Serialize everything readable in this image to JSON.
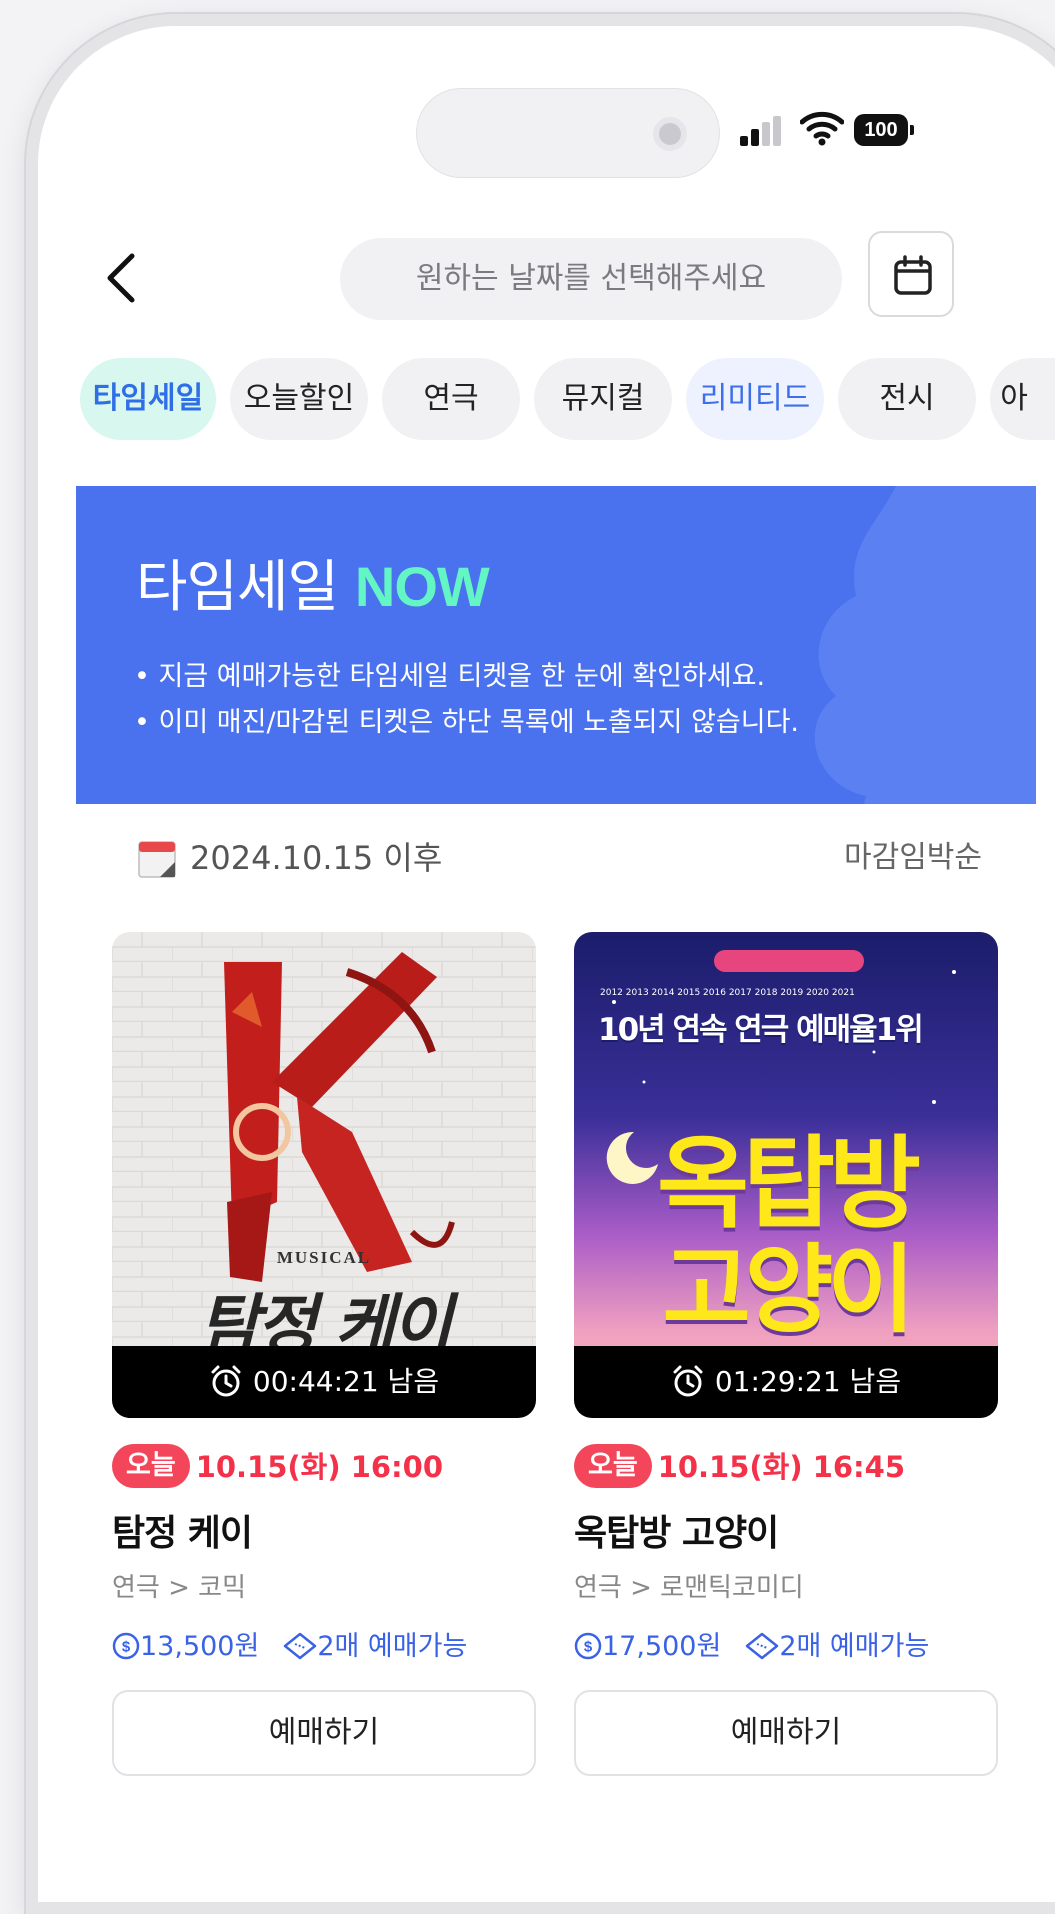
{
  "status_bar": {
    "battery": "100"
  },
  "header": {
    "date_placeholder": "원하는 날짜를 선택해주세요"
  },
  "chips": [
    {
      "label": "타임세일"
    },
    {
      "label": "오늘할인"
    },
    {
      "label": "연극"
    },
    {
      "label": "뮤지컬"
    },
    {
      "label": "리미티드"
    },
    {
      "label": "전시"
    },
    {
      "label": "아"
    }
  ],
  "banner": {
    "title": "타임세일",
    "title_highlight": "NOW",
    "lines": [
      "지금 예매가능한 타임세일 티켓을 한 눈에 확인하세요.",
      "이미 매진/마감된 티켓은 하단 목록에 노출되지 않습니다."
    ]
  },
  "filter": {
    "date": "2024.10.15 이후",
    "sort": "마감임박순"
  },
  "products": [
    {
      "poster_musical": "MUSICAL",
      "poster_title": "탐정 케이",
      "timer": "00:44:21 남음",
      "badge": "오늘",
      "datetime": "10.15(화) 16:00",
      "title": "탐정 케이",
      "category": "연극 > 코믹",
      "price": "13,500원",
      "availability": "2매 예매가능",
      "button": "예매하기"
    },
    {
      "poster_top": "2012 2013 2014 2015 2016 2017 2018 2019 2020 2021",
      "poster_headline": "10년 연속 연극 예매율1위",
      "poster_title_1": "옥탑방",
      "poster_title_2": "고양이",
      "timer": "01:29:21 남음",
      "badge": "오늘",
      "datetime": "10.15(화) 16:45",
      "title": "옥탑방 고양이",
      "category": "연극 > 로맨틱코미디",
      "price": "17,500원",
      "availability": "2매 예매가능",
      "button": "예매하기"
    }
  ],
  "colors": {
    "banner": "#4a72ee",
    "accent_mint": "#63f5c4",
    "sale_red": "#f3324a",
    "link_blue": "#3a62e6"
  }
}
